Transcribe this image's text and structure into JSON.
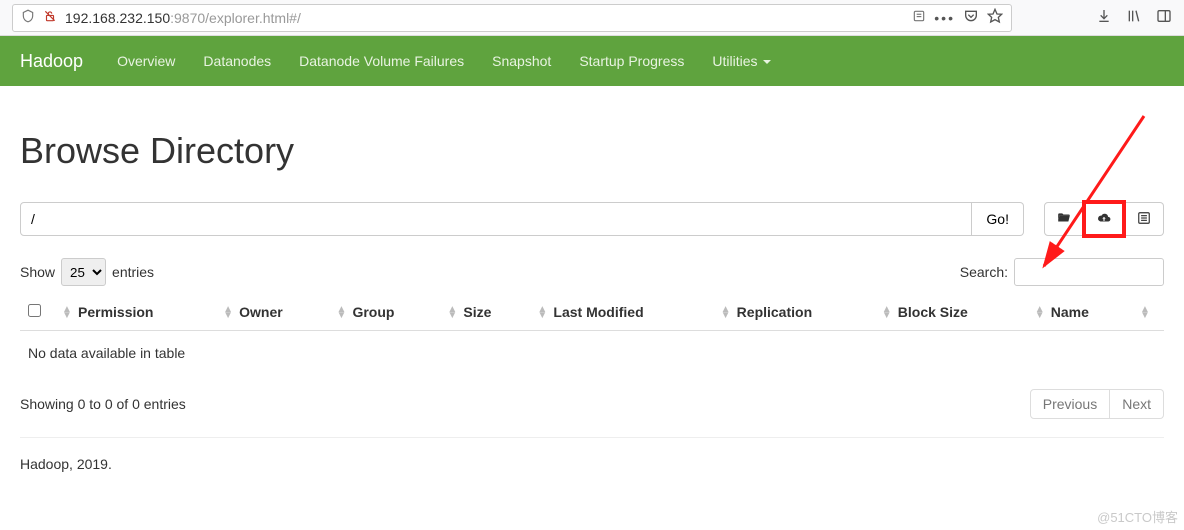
{
  "browser": {
    "url_host": "192.168.232.150",
    "url_rest": ":9870/explorer.html#/"
  },
  "nav": {
    "brand": "Hadoop",
    "items": [
      "Overview",
      "Datanodes",
      "Datanode Volume Failures",
      "Snapshot",
      "Startup Progress",
      "Utilities"
    ]
  },
  "page": {
    "title": "Browse Directory",
    "path_value": "/",
    "go_label": "Go!"
  },
  "datatable": {
    "show_label": "Show",
    "entries_label": "entries",
    "page_size": "25",
    "search_label": "Search:",
    "search_value": "",
    "columns": [
      "Permission",
      "Owner",
      "Group",
      "Size",
      "Last Modified",
      "Replication",
      "Block Size",
      "Name"
    ],
    "empty_message": "No data available in table",
    "info": "Showing 0 to 0 of 0 entries",
    "prev_label": "Previous",
    "next_label": "Next"
  },
  "footer": {
    "text": "Hadoop, 2019."
  },
  "watermark": "@51CTO博客"
}
